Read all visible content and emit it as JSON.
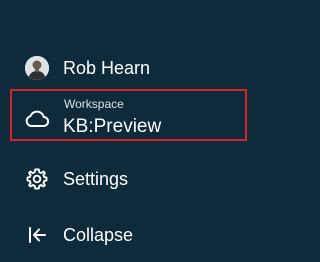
{
  "user": {
    "name": "Rob Hearn"
  },
  "workspace": {
    "caption": "Workspace",
    "name": "KB:Preview",
    "icon": "cloud-icon"
  },
  "settings": {
    "label": "Settings",
    "icon": "gear-icon"
  },
  "collapse": {
    "label": "Collapse",
    "icon": "collapse-left-icon"
  },
  "colors": {
    "background": "#0f2a3a",
    "highlight_border": "#d4242b",
    "text": "#ffffff"
  }
}
